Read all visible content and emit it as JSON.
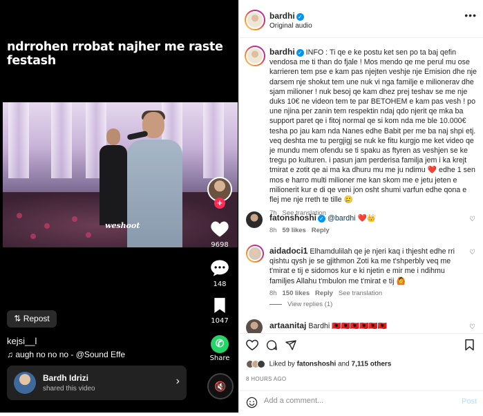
{
  "video": {
    "overlay_text": "ndrrohen rrobat najher me raste festash",
    "watermark": "weshoot",
    "likes": "9698",
    "comments": "148",
    "saves": "1047",
    "share_label": "Share",
    "repost_label": "Repost",
    "author": "kejsi__l",
    "sound": "augh no no no - @Sound Effe",
    "shared_by": {
      "name": "Bardh Idrizi",
      "sub": "shared this video"
    }
  },
  "post": {
    "username": "bardhi",
    "audio": "Original audio",
    "caption": "INFO : Ti qe e ke postu ket sen po ta baj qefin vendosa me ti than do fjale ! Mos mendo qe me perul mu ose karrieren tem pse e kam pas njejten veshje nje Emision dhe nje darsem nje shokut tem une nuk vi nga familje e milionerav dhe sjam milioner ! nuk besoj qe kam dhez prej teshav se me nje duks 10€ ne videon tem te par BETOHEM e kam pas vesh ! po une njina per zanin tem respektin ndaj qdo njerit qe mka ba support paret qe i fitoj normal qe si kom nda me ble 10.000€ tesha po jau kam nda Nanes edhe Babit per me ba naj shpi etj. veq deshta me tu pergjigj se nuk ke fitu kurgjo me ket video qe je mundu mem ofendu se ti spaku as ftyren as veshjen se ke tregu po kulturen. i pasun jam perderisa familja jem i ka krejt tmirat e zotit qe ai ma ka dhuru mu me ju ndimu",
    "caption_heart": "❤️",
    "caption_end": "edhe 1 sen mos e harro multi milioner me kan skom me e jetu jeten e milionerit kur e di qe veni jon osht shumi varfun edhe qona e flej me nje rreth te tille 🥲",
    "caption_time": "7h",
    "see_translation": "See translation",
    "comments": [
      {
        "user": "fatonshoshi",
        "mention": "@bardhi",
        "text": "❤️👑",
        "time": "8h",
        "likes": "59 likes",
        "reply": "Reply"
      },
      {
        "user": "aidadoci1",
        "text": "Elhamdulilah qe je njeri kaq i thjesht edhe rri qishtu qysh je se gjithmon Zoti ka me t'shperbly veq me t'mirat e tij e sidomos kur e ki njetin e mir me i ndihmu familjes Allahu t'mbulon me t'mirat e tij 🙆",
        "time": "8h",
        "likes": "150 likes",
        "reply": "Reply",
        "translation": "See translation"
      },
      {
        "user": "artaanitaj",
        "text": "Bardhi 🇦🇱🇦🇱🇦🇱🇦🇱🇦🇱🇦🇱"
      }
    ],
    "view_replies": "View replies (1)",
    "liked_by_prefix": "Liked by",
    "liked_by_user": "fatonshoshi",
    "liked_by_and": "and",
    "liked_by_count": "7,115 others",
    "ago": "8 HOURS AGO",
    "add_comment_placeholder": "Add a comment...",
    "post_label": "Post"
  },
  "colors": {
    "accent": "#0095f6",
    "like_red": "#ed4956",
    "tiktok_red": "#fe2c55",
    "whatsapp": "#25d366"
  }
}
